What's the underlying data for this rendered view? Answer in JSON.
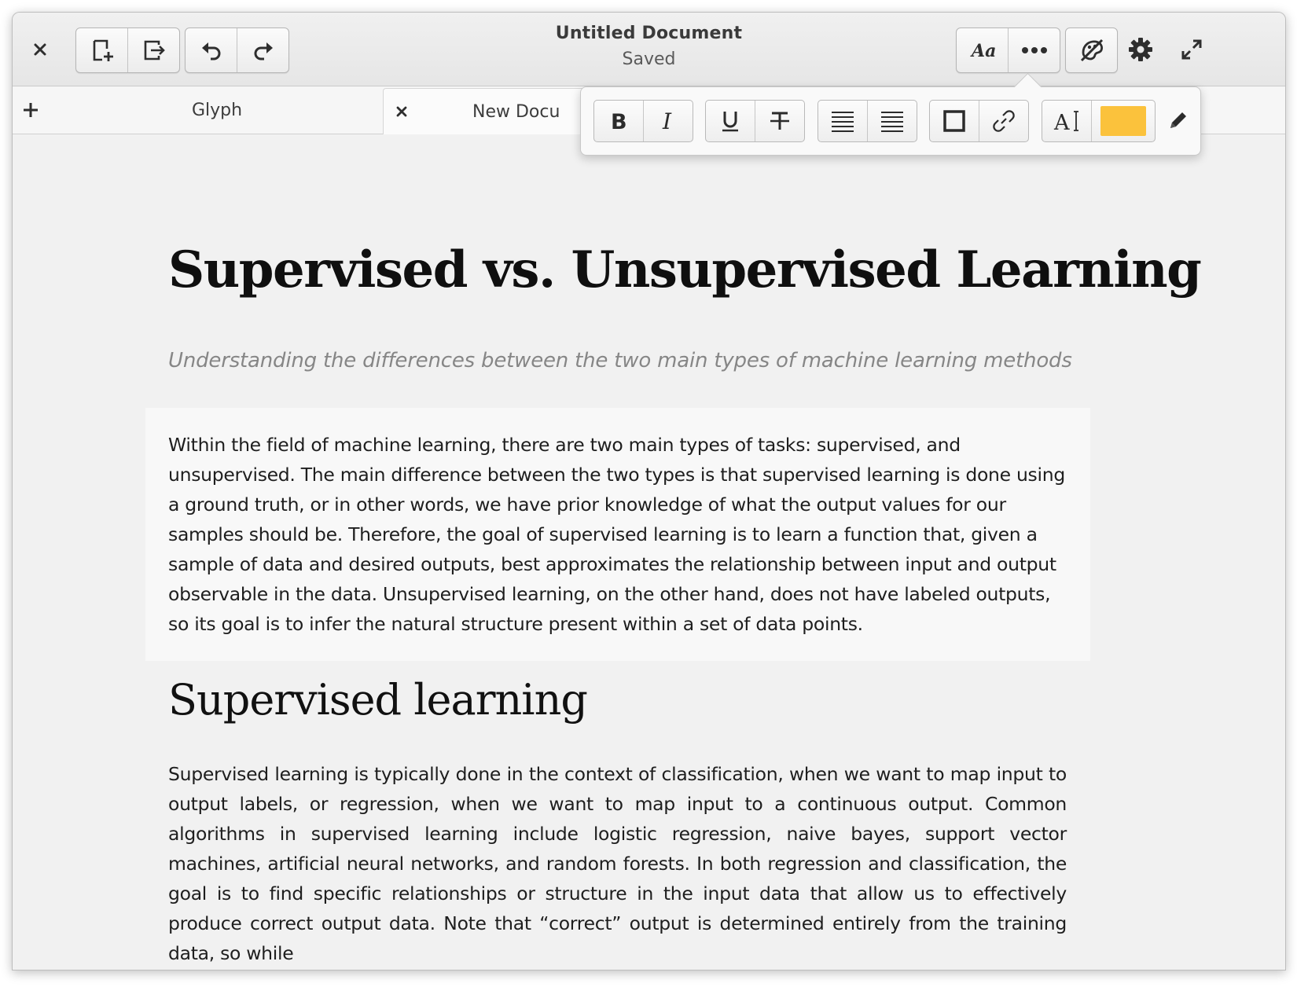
{
  "window": {
    "title": "Untitled Document",
    "status": "Saved"
  },
  "tabs": [
    {
      "label": "Glyph",
      "active": false
    },
    {
      "label": "New Docu",
      "active": true
    }
  ],
  "format_toolbar": {
    "highlight_color": "#fbc23c"
  },
  "document": {
    "heading": "Supervised vs. Unsupervised Learning",
    "subtitle": "Understanding the differences between the two main types of machine learning methods",
    "intro_paragraph": "Within the field of machine learning, there are two main types of tasks: supervised, and unsupervised. The main difference between the two types is that supervised learning is done using a ground truth, or in other words, we have prior knowledge of what the output values for our samples should be. Therefore, the goal of supervised learning is to learn a function that, given a sample of data and desired outputs, best approximates the relationship between input and output observable in the data. Unsupervised learning, on the other hand, does not have labeled outputs, so its goal is to infer the natural structure present within a set of data points.",
    "section_heading": "Supervised learning",
    "section_paragraph": "Supervised learning is typically done in the context of classification, when we want to map input to output labels, or regression, when we want to map input to a continuous output. Common algorithms in supervised learning include logistic regression, naive bayes, support vector machines, artificial neural networks, and random forests. In both regression and classification, the goal is to find specific relationships or structure in the input data that allow us to effectively produce correct output data. Note that “correct” output is determined entirely from the training data, so while"
  },
  "icons": {
    "close": "close-icon",
    "new_document": "new-document-icon",
    "export": "export-icon",
    "undo": "undo-icon",
    "redo": "redo-icon",
    "font": "font-icon",
    "more": "more-icon",
    "focus_mode": "focus-mode-icon",
    "settings": "gear-icon",
    "fullscreen": "fullscreen-icon",
    "add_tab": "add-tab-icon"
  }
}
